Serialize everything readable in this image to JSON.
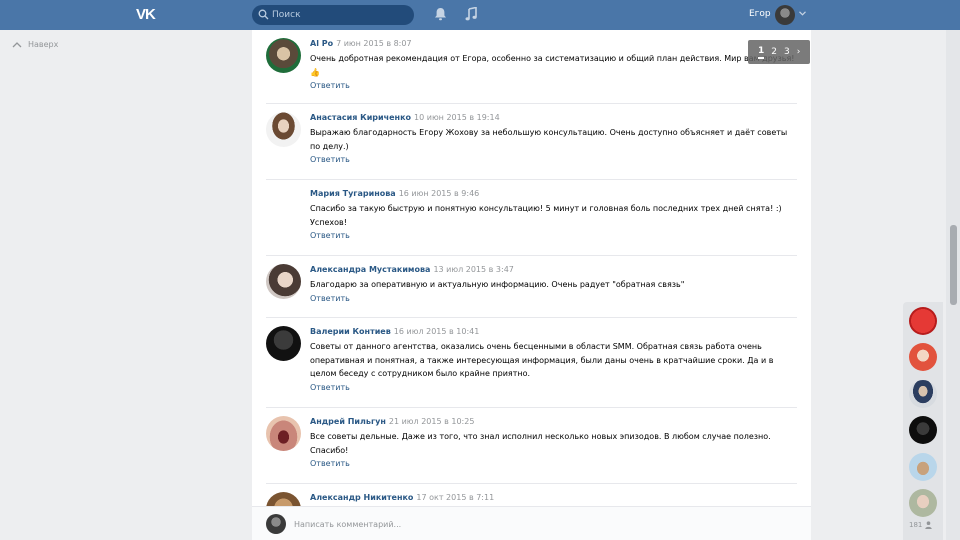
{
  "header": {
    "logo_text": "VK",
    "search_placeholder": "Поиск",
    "user_name": "Егор"
  },
  "nav": {
    "back_label": "Наверх"
  },
  "pager": {
    "pages": [
      "1",
      "2",
      "3"
    ],
    "current": "1",
    "next": "›"
  },
  "comments": [
    {
      "author": "Al Po",
      "date": "7 июн 2015 в 8:07",
      "text": "Очень добротная рекомендация от Егора, особенно за систематизацию и общий план действия. Мир вам друзья! 👍",
      "reply": "Ответить"
    },
    {
      "author": "Анастасия Кириченко",
      "date": "10 июн 2015 в 19:14",
      "text": "Выражаю благодарность Егору Жохову за небольшую консультацию. Очень доступно объясняет и даёт советы по делу.)",
      "reply": "Ответить"
    },
    {
      "author": "Мария Тугаринова",
      "date": "16 июн 2015 в 9:46",
      "text": "Спасибо за такую быструю и понятную консультацию! 5 минут и головная боль последних трех дней снята! :) Успехов!",
      "reply": "Ответить"
    },
    {
      "author": "Александра Мустакимова",
      "date": "13 июл 2015 в 3:47",
      "text": "Благодарю за оперативную и актуальную информацию. Очень радует \"обратная связь\"",
      "reply": "Ответить"
    },
    {
      "author": "Валерии Контиев",
      "date": "16 июл 2015 в 10:41",
      "text": "Советы от данного агентства, оказались очень бесценными в области SMM. Обратная связь работа очень оперативная и понятная, а также интересующая информация, были даны очень в кратчайшие сроки. Да и в целом беседу с сотрудником было крайне приятно.",
      "reply": "Ответить"
    },
    {
      "author": "Андрей Пильгун",
      "date": "21 июл 2015 в 10:25",
      "text": "Все советы дельные. Даже из того, что знал исполнил несколько новых эпизодов. В любом случае полезно. Спасибо!",
      "reply": "Ответить"
    },
    {
      "author": "Александр Никитенко",
      "date": "17 окт 2015 в 7:11",
      "text": "",
      "reply": ""
    }
  ],
  "composer": {
    "placeholder": "Написать комментарий..."
  },
  "chats": {
    "count": "181"
  },
  "colors": {
    "header_bg": "#4a76a8",
    "link": "#2a5885",
    "muted": "#939699",
    "page_bg": "#edeef0"
  }
}
